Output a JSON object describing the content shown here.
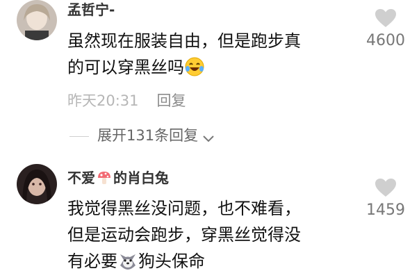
{
  "comments": [
    {
      "username": "孟哲宁-",
      "lines": [
        "虽然现在服装自由，但是跑步真",
        "的可以穿黑丝吗"
      ],
      "time": "昨天20:31",
      "reply_label": "回复",
      "likes": "4600"
    },
    {
      "username_a": "不爱",
      "username_b": "的肖白兔",
      "lines": [
        "我觉得黑丝没问题，也不难看，",
        "但是运动会跑步，穿黑丝觉得没",
        "有必要",
        "狗头保命"
      ],
      "likes": "1459"
    }
  ],
  "expand_replies": "展开131条回复",
  "icons": {
    "like": "heart-icon",
    "laugh": "laughing-emoji-icon",
    "mushroom": "mushroom-icon",
    "dog": "dog-head-emoji-icon",
    "chevron": "chevron-down-icon"
  }
}
